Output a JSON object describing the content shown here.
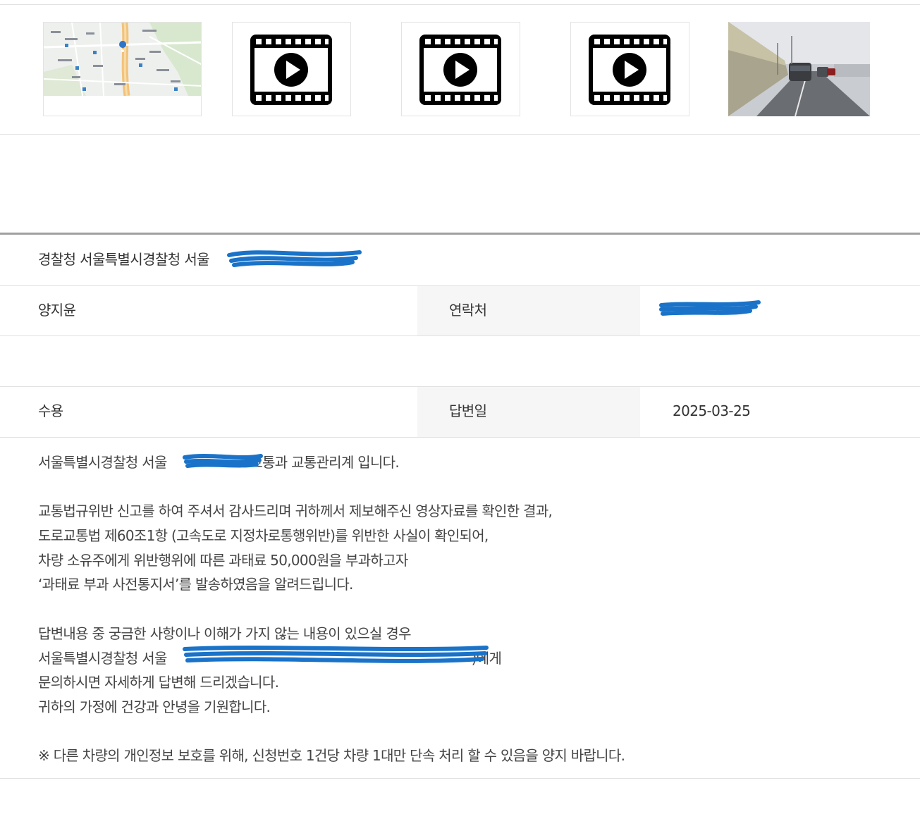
{
  "attachments": [
    {
      "kind": "map-image",
      "icon": "map-thumbnail"
    },
    {
      "kind": "video",
      "icon": "film-play-icon"
    },
    {
      "kind": "video",
      "icon": "film-play-icon"
    },
    {
      "kind": "video",
      "icon": "film-play-icon"
    },
    {
      "kind": "photo",
      "icon": "road-photo-thumbnail"
    }
  ],
  "agency": {
    "text": "경찰청 서울특별시경찰청 서울"
  },
  "contact_row": {
    "name": "양지윤",
    "contact_label": "연락처"
  },
  "result_row": {
    "status": "수용",
    "answer_date_label": "답변일",
    "answer_date": "2025-03-25"
  },
  "answer": {
    "line1_prefix": "서울특별시경찰청 서울",
    "line1_suffix": " 교통과 교통관리계 입니다.",
    "line2": "교통법규위반 신고를 하여 주셔서 감사드리며 귀하께서 제보해주신 영상자료를 확인한 결과,",
    "line3": "도로교통법 제60조1항 (고속도로 지정차로통행위반)를 위반한 사실이 확인되어,",
    "line4": "차량 소유주에게 위반행위에 따른 과태료 50,000원을 부과하고자",
    "line5": "‘과태료 부과 사전통지서’를 발송하였음을 알려드립니다.",
    "line6": "답변내용 중 궁금한 사항이나 이해가 가지 않는 내용이 있으실 경우",
    "line7_prefix": "서울특별시경찰청 서울",
    "line7_suffix": ")에게",
    "line8": "문의하시면 자세하게 답변해 드리겠습니다.",
    "line9": "귀하의 가정에 건강과 안녕을 기원합니다.",
    "line10": "※ 다른 차량의 개인정보 보호를 위해, 신청번호 1건당 차량 1대만 단속 처리 할 수 있음을 양지 바랍니다."
  },
  "colors": {
    "redaction": "#1a73c8",
    "label_bg": "#f6f6f6",
    "divider": "#e1e1e1",
    "section_border": "#a0a0a0"
  }
}
